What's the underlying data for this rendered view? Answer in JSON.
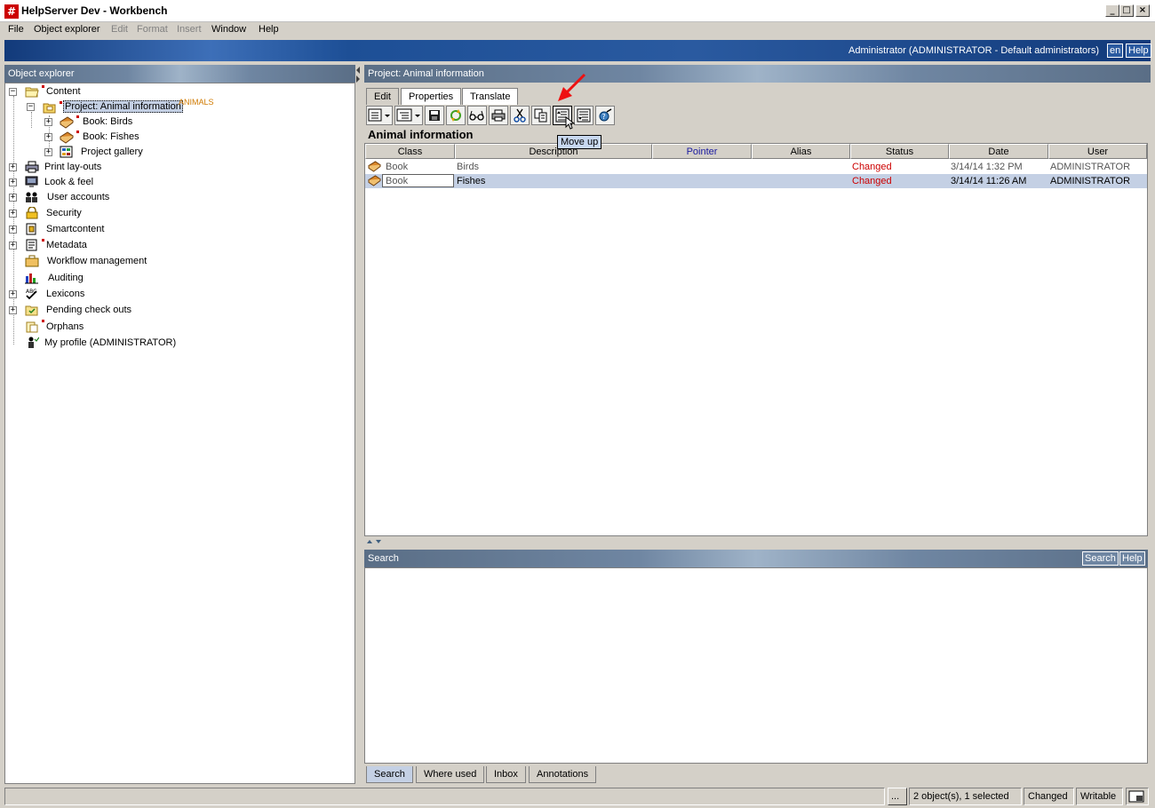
{
  "window": {
    "title": "HelpServer Dev - Workbench",
    "icon_glyph": "#",
    "min": "_",
    "max": "□",
    "close": "×"
  },
  "menu": [
    "File",
    "Object explorer",
    "Edit",
    "Format",
    "Insert",
    "Window",
    "Help"
  ],
  "banner": {
    "user": "Administrator (ADMINISTRATOR - Default administrators)",
    "lang_btn": "en",
    "help_btn": "Help"
  },
  "explorer": {
    "title": "Object explorer",
    "tree": {
      "content": "Content",
      "project": "Project: Animal information",
      "project_alias": "ANIMALS",
      "book_birds": "Book: Birds",
      "book_fishes": "Book: Fishes",
      "gallery": "Project gallery",
      "print": "Print lay-outs",
      "look": "Look & feel",
      "users": "User accounts",
      "security": "Security",
      "smart": "Smartcontent",
      "metadata": "Metadata",
      "workflow": "Workflow management",
      "auditing": "Auditing",
      "lexicons": "Lexicons",
      "pending": "Pending check outs",
      "orphans": "Orphans",
      "profile": "My profile (ADMINISTRATOR)"
    }
  },
  "editor": {
    "header": "Project: Animal information",
    "tabs": [
      "Edit",
      "Properties",
      "Translate"
    ],
    "content_title": "Animal information",
    "tooltip": "Move up",
    "columns": [
      "Class",
      "Description",
      "Pointer",
      "Alias",
      "Status",
      "Date",
      "User"
    ],
    "rows": [
      {
        "class": "Book",
        "description": "Birds",
        "pointer": "",
        "alias": "",
        "status": "Changed",
        "date": "3/14/14 1:32 PM",
        "user": "ADMINISTRATOR"
      },
      {
        "class": "Book",
        "description": "Fishes",
        "pointer": "",
        "alias": "",
        "status": "Changed",
        "date": "3/14/14 11:26 AM",
        "user": "ADMINISTRATOR"
      }
    ]
  },
  "search": {
    "title": "Search",
    "search_btn": "Search",
    "help_btn": "Help"
  },
  "bottom_tabs": [
    "Search",
    "Where used",
    "Inbox",
    "Annotations"
  ],
  "status": {
    "dots": "...",
    "count": "2 object(s), 1 selected",
    "state": "Changed",
    "mode": "Writable"
  },
  "colors": {
    "accent_red": "#cc0000",
    "selection": "#c4d0e4",
    "banner": "#2a5aa0"
  }
}
